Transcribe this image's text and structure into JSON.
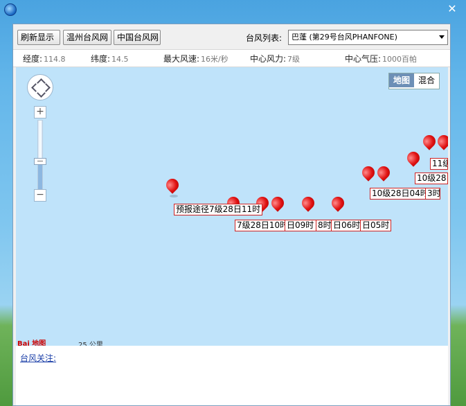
{
  "toolbar": {
    "refresh_label": "刷新显示",
    "wenzhou_label": "温州台风网",
    "china_label": "中国台风网",
    "typhoon_list_label": "台风列表:",
    "typhoon_selected": "巴蓬 (第29号台风PHANFONE)"
  },
  "info": {
    "lng_label": "经度:",
    "lng_value": "114.8",
    "lat_label": "纬度:",
    "lat_value": "14.5",
    "maxwind_label": "最大风速:",
    "maxwind_value": "16米/秒",
    "force_label": "中心风力:",
    "force_value": "7级",
    "pressure_label": "中心气压:",
    "pressure_value": "1000百帕"
  },
  "map": {
    "maptype_map": "地图",
    "maptype_hybrid": "混合",
    "logo_text": "Bai 地图",
    "scale_text": "25 公里",
    "labels": [
      "预报途径7级28日11时",
      "7级28日10时",
      "日09时",
      "8时",
      "日06时",
      "日05时",
      "10级28日04时",
      "3时",
      "10级28日",
      "11级"
    ]
  },
  "footer": {
    "follow_label": "台风关注:"
  },
  "colors": {
    "accent": "#e01212",
    "map_bg": "#bfe3fa",
    "maptype_active": "#6d8fb6"
  },
  "icons": {
    "app": "app-globe-icon",
    "close": "close-icon",
    "pin": "map-pin-icon"
  }
}
